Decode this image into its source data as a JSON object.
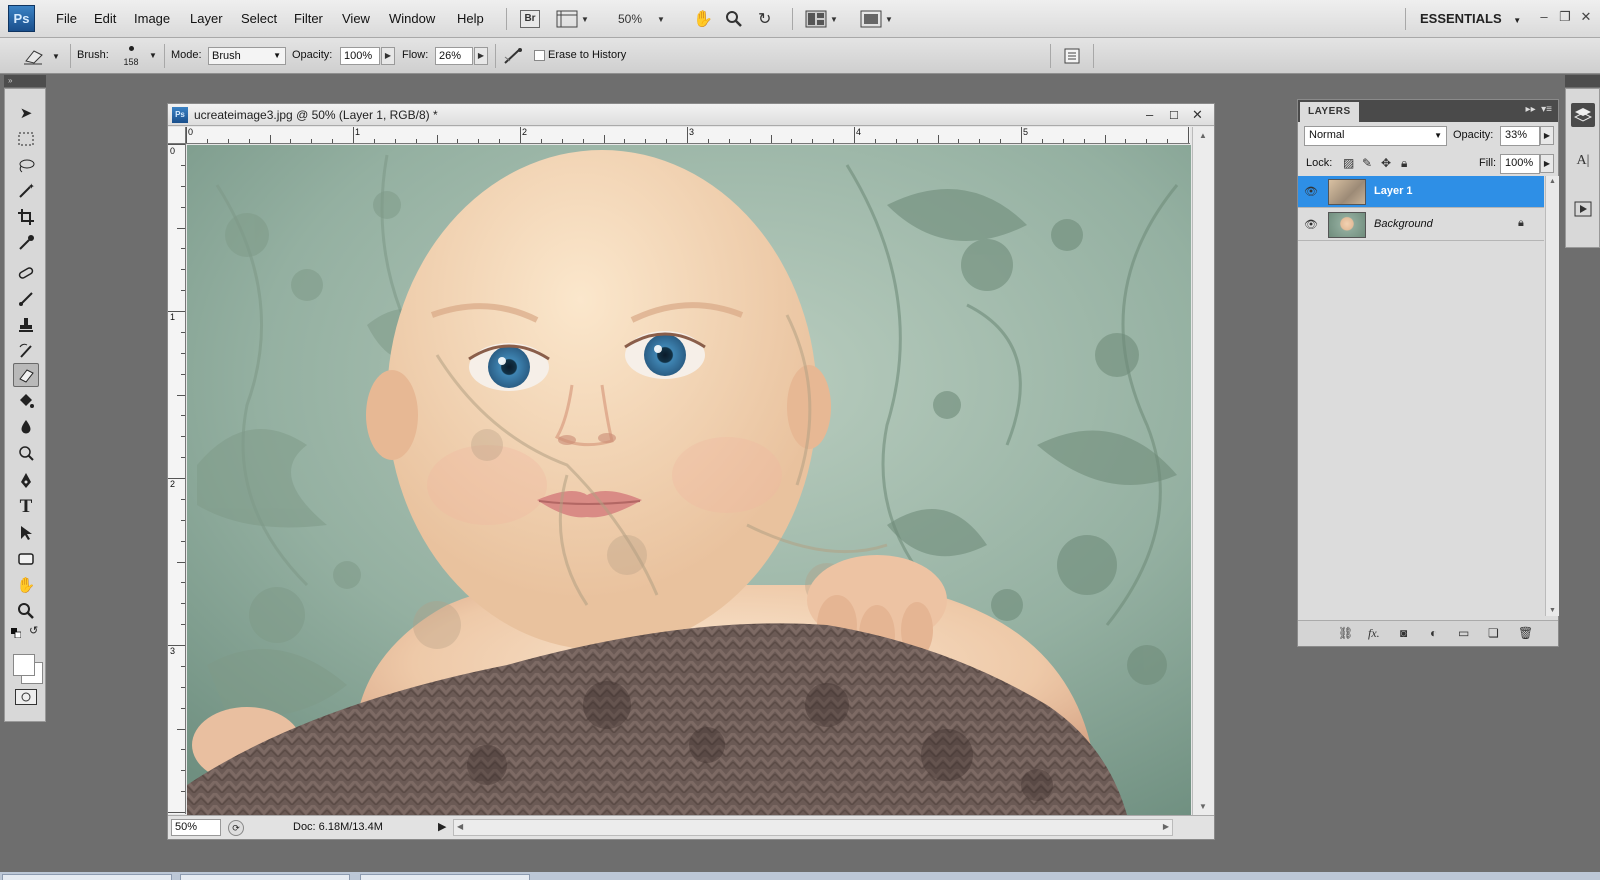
{
  "app": {
    "logo": "Ps"
  },
  "menu": [
    "File",
    "Edit",
    "Image",
    "Layer",
    "Select",
    "Filter",
    "View",
    "Window",
    "Help"
  ],
  "menubar": {
    "bridge_label": "Br",
    "zoom": "50%",
    "workspace": "ESSENTIALS",
    "minimize_glyph": "–",
    "restore_glyph": "❐",
    "close_glyph": "✕"
  },
  "options": {
    "brush_label": "Brush:",
    "brush_size": "158",
    "mode_label": "Mode:",
    "mode_value": "Brush",
    "opacity_label": "Opacity:",
    "opacity_value": "100%",
    "flow_label": "Flow:",
    "flow_value": "26%",
    "erase_to_history": "Erase to History",
    "erase_to_history_checked": false
  },
  "tools_panel": {
    "collapse_glyph": "»"
  },
  "tools": [
    "move-tool",
    "marquee-tool",
    "lasso-tool",
    "quick-select-tool",
    "crop-tool",
    "eyedropper-tool",
    "healing-tool",
    "brush-tool",
    "clone-stamp-tool",
    "history-brush-tool",
    "eraser-tool",
    "paint-bucket-tool",
    "blur-tool",
    "dodge-tool",
    "pen-tool",
    "type-tool",
    "path-select-tool",
    "shape-tool",
    "hand-tool",
    "zoom-tool",
    "default-colors",
    "swap-colors",
    "foreground-color",
    "quick-mask"
  ],
  "active_tool": "eraser-tool",
  "document": {
    "title": "ucreateimage3.jpg @ 50% (Layer 1, RGB/8) *",
    "icon": "Ps",
    "zoom": "50%",
    "doc_info": "Doc: 6.18M/13.4M",
    "ruler_top": [
      "0",
      "1",
      "2",
      "3",
      "4",
      "5"
    ],
    "ruler_left": [
      "0",
      "1",
      "2",
      "3"
    ]
  },
  "layers_panel": {
    "tab": "LAYERS",
    "blend_mode": "Normal",
    "opacity_label": "Opacity:",
    "opacity_value": "33%",
    "lock_label": "Lock:",
    "fill_label": "Fill:",
    "fill_value": "100%",
    "layers": [
      {
        "name": "Layer 1",
        "selected": true,
        "locked": false
      },
      {
        "name": "Background",
        "selected": false,
        "locked": true
      }
    ],
    "footer_icons": [
      "link-layers-icon",
      "fx-icon",
      "add-mask-icon",
      "adjustment-layer-icon",
      "new-group-icon",
      "new-layer-icon",
      "delete-layer-icon"
    ]
  },
  "colors": {
    "selection": "#2e8fe6",
    "canvas_bg": "#9fb7a9"
  }
}
